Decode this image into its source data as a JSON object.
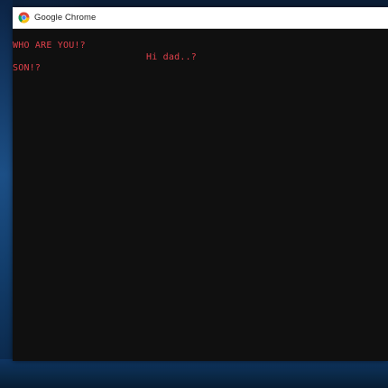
{
  "window": {
    "title": "Google Chrome",
    "icon": "chrome-icon"
  },
  "console": {
    "text_color": "#e0414b",
    "background": "#101010",
    "lines": [
      "WHO ARE YOU!?",
      "Hi dad..?",
      "SON!?"
    ]
  }
}
